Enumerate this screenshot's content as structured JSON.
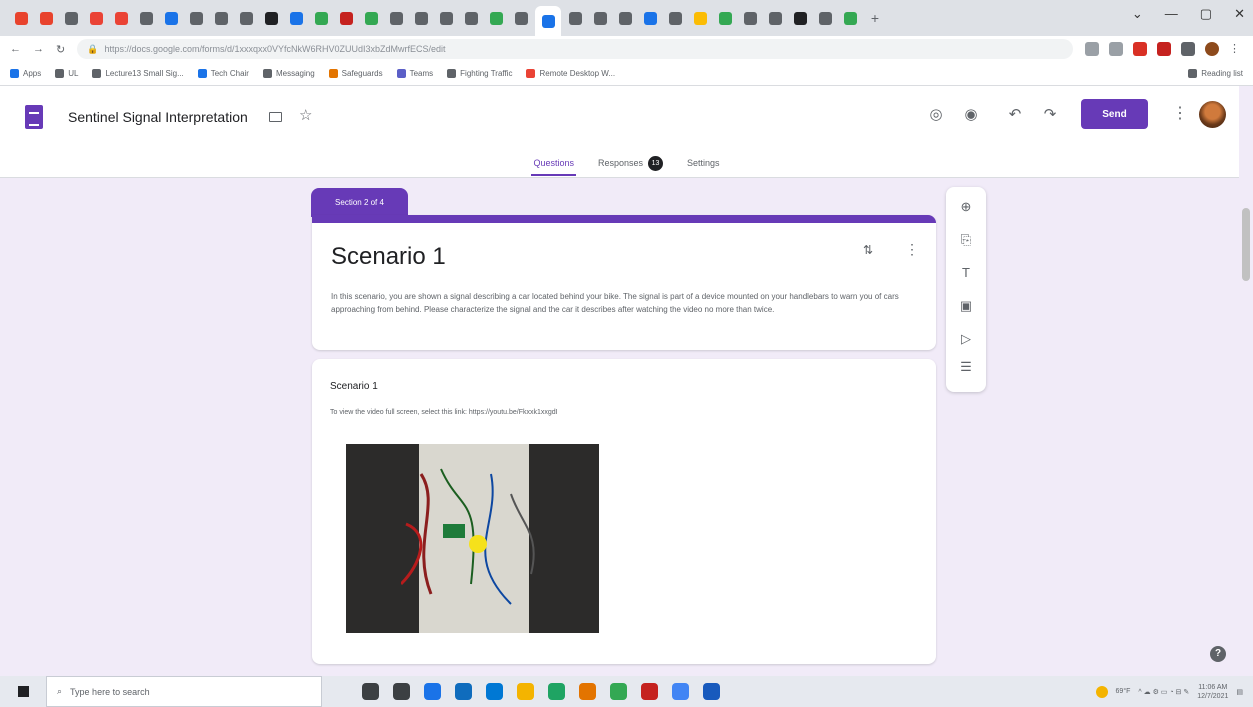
{
  "browser": {
    "tab_colors": [
      "#e8432d",
      "#e8432d",
      "#5f6368",
      "#ea4335",
      "#ea4335",
      "#5f6368",
      "#1a73e8",
      "#5f6368",
      "#5f6368",
      "#5f6368",
      "#202124",
      "#1a73e8",
      "#34a853",
      "#c5221f",
      "#34a853",
      "#5f6368",
      "#5f6368",
      "#5f6368",
      "#5f6368",
      "#34a853",
      "#5f6368",
      "#1a73e8",
      "#5f6368",
      "#5f6368",
      "#5f6368",
      "#1a73e8",
      "#5f6368",
      "#fbbc04",
      "#34a853",
      "#5f6368",
      "#5f6368",
      "#202124",
      "#5f6368",
      "#34a853"
    ],
    "new_tab_label": "+",
    "window_controls": [
      "⌄",
      "—",
      "▢",
      "✕"
    ],
    "url": "https://docs.google.com/forms/d/1xxxqxx0VYfcNkW6RHV0ZUUdI3xbZdMwrfECS/edit",
    "bookmarks": [
      {
        "label": "Apps",
        "color": "#1a73e8"
      },
      {
        "label": "UL",
        "color": "#5f6368"
      },
      {
        "label": "Lecture13 Small Sig...",
        "color": "#5f6368"
      },
      {
        "label": "Tech Chair",
        "color": "#1a73e8"
      },
      {
        "label": "Messaging",
        "color": "#5f6368"
      },
      {
        "label": "Safeguards",
        "color": "#e37400"
      },
      {
        "label": "Teams",
        "color": "#5b5fc7"
      },
      {
        "label": "Fighting Traffic",
        "color": "#5f6368"
      },
      {
        "label": "Remote Desktop W...",
        "color": "#ea4335"
      }
    ],
    "reading_list": "Reading list"
  },
  "forms": {
    "title": "Sentinel Signal Interpretation",
    "send_label": "Send",
    "tabs": [
      {
        "label": "Questions",
        "active": true
      },
      {
        "label": "Responses",
        "badge": "13"
      },
      {
        "label": "Settings"
      }
    ],
    "accent": "#673ab7"
  },
  "section": {
    "tab_label": "Section 2 of 4",
    "title": "Scenario 1",
    "description": "In this scenario, you are shown a signal describing a car located behind your bike. The signal is part of a device mounted on your handlebars to warn you of cars approaching from behind. Please characterize the signal and the car it describes after watching the video no more than twice."
  },
  "video_item": {
    "title": "Scenario 1",
    "description": "To view the video full screen, select this link: https://youtu.be/Fkxxk1xxgdI"
  },
  "toolbar": [
    "add-question",
    "import-questions",
    "add-title",
    "add-image",
    "add-video",
    "add-section"
  ],
  "taskbar": {
    "search_placeholder": "Type here to search",
    "app_colors": [
      "#3c4043",
      "#3c4043",
      "#1a73e8",
      "#0f6cbd",
      "#0078d4",
      "#f4b400",
      "#1fa463",
      "#e37400",
      "#34a853",
      "#c5221f",
      "#4285f4",
      "#185abd"
    ],
    "temperature": "69°F",
    "time": "11:06 AM",
    "date": "12/7/2021"
  }
}
